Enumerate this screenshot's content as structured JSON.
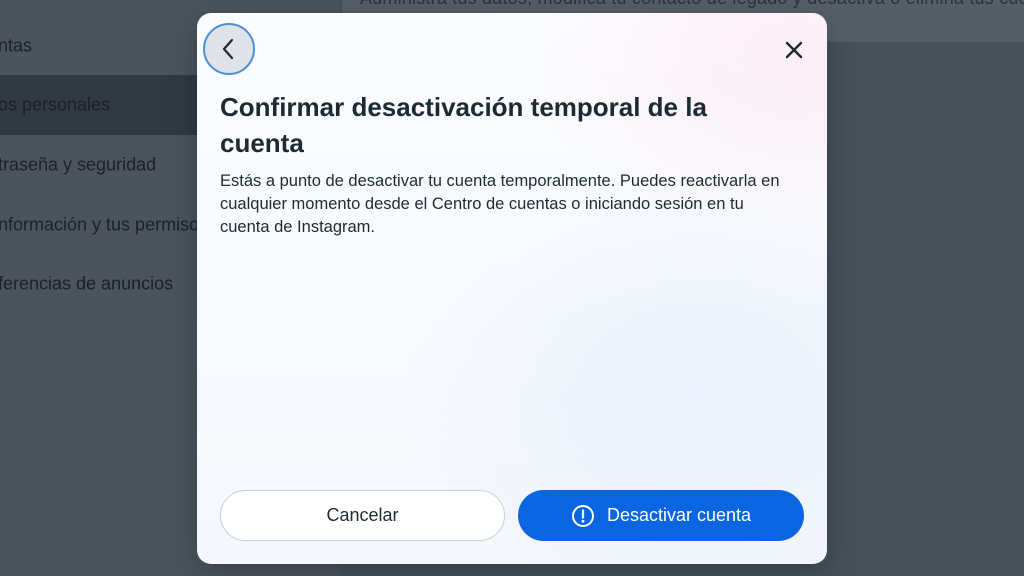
{
  "background": {
    "topbar_text": "Administra tus datos, modifica tu contacto de legado y desactiva o elimina tus cuentas",
    "sidebar_items": [
      {
        "label": "ntas"
      },
      {
        "label": "os personales",
        "active": true
      },
      {
        "label": "traseña y seguridad"
      },
      {
        "label": "nformación y tus permisos"
      },
      {
        "label": "ferencias de anuncios"
      }
    ]
  },
  "modal": {
    "back_icon": "chevron-left-icon",
    "close_icon": "close-icon",
    "title": "Confirmar desactivación temporal de la cuenta",
    "body": "Estás a punto de desactivar tu cuenta temporalmente. Puedes reactivarla en cualquier momento desde el Centro de cuentas o iniciando sesión en tu cuenta de Instagram.",
    "cancel_label": "Cancelar",
    "deactivate_label": "Desactivar cuenta",
    "deactivate_icon": "warning-circle-icon"
  },
  "colors": {
    "primary": "#0a66e0",
    "text": "#1c2b33",
    "overlay": "#48525b"
  }
}
